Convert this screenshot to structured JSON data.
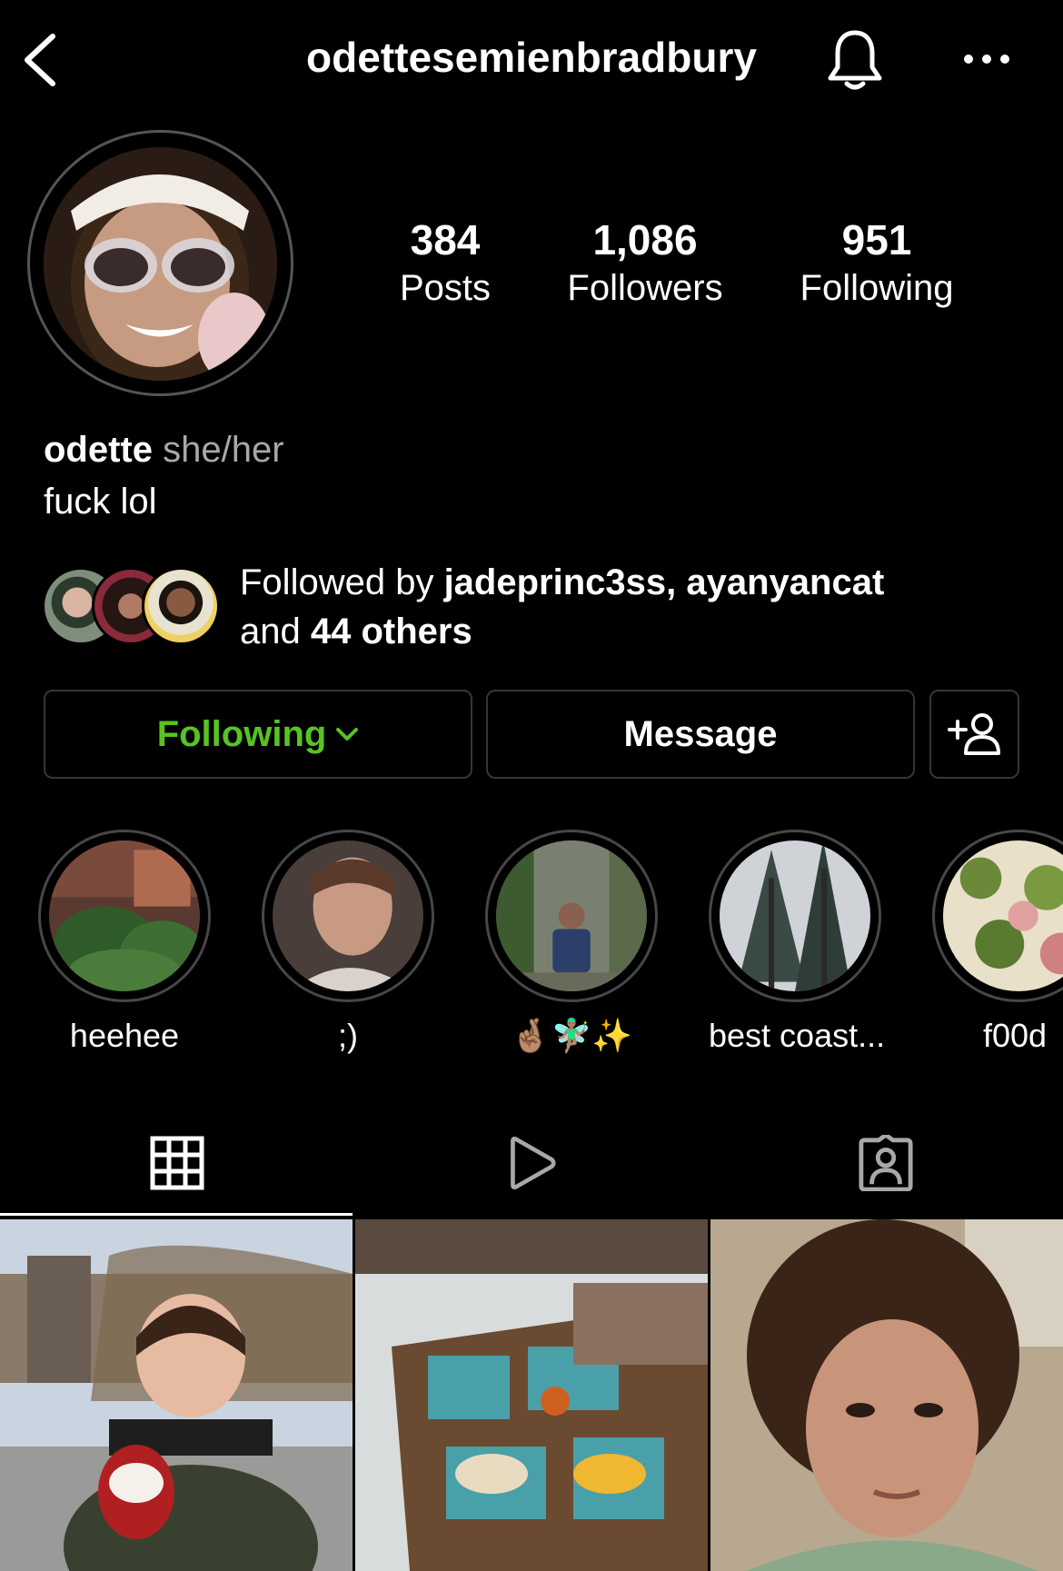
{
  "header": {
    "username": "odettesemienbradbury"
  },
  "stats": {
    "posts": {
      "value": "384",
      "label": "Posts"
    },
    "followers": {
      "value": "1,086",
      "label": "Followers"
    },
    "following": {
      "value": "951",
      "label": "Following"
    }
  },
  "bio": {
    "name": "odette",
    "pronouns": "she/her",
    "text": "fuck lol"
  },
  "followed_by": {
    "prefix": "Followed by ",
    "users": "jadeprinc3ss, ayanyancat",
    "middle": "and ",
    "others": "44 others"
  },
  "actions": {
    "following_label": "Following",
    "message_label": "Message"
  },
  "highlights": [
    {
      "label": "heehee"
    },
    {
      "label": ";)"
    },
    {
      "label": "🤞🏽🧚🏽‍♂️✨"
    },
    {
      "label": "best coast..."
    },
    {
      "label": "f00d"
    }
  ],
  "tabs": [
    {
      "icon": "grid-icon",
      "active": true
    },
    {
      "icon": "reels-icon",
      "active": false
    },
    {
      "icon": "tagged-icon",
      "active": false
    }
  ],
  "colors": {
    "background": "#000000",
    "following_accent": "#58c322",
    "border": "#363636",
    "secondary_text": "#a8a8a8"
  }
}
